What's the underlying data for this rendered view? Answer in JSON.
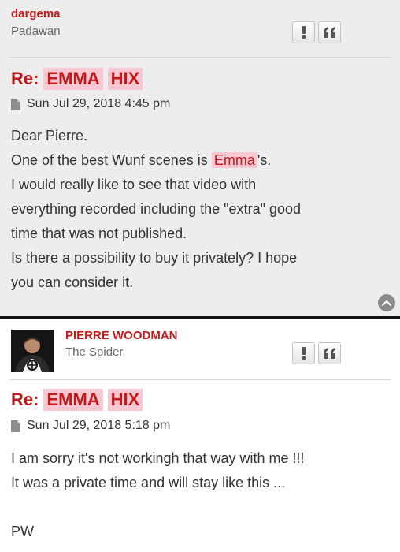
{
  "post1": {
    "username": "dargema",
    "rank": "Padawan",
    "title_prefix": "Re:",
    "title_word1": "EMMA",
    "title_word2": "HIX",
    "timestamp": "Sun Jul 29, 2018 4:45 pm",
    "body": {
      "greeting": "Dear Pierre.",
      "line2_before": "One of the best Wunf scenes is",
      "line2_highlight": "Emma",
      "line2_after": "'s.",
      "line3": "I would really like to see that video with",
      "line4": "everything recorded including the \"extra\" good",
      "line5": "time that was not published.",
      "line6": "Is there a possibility to buy it privately? I hope",
      "line7": "you can consider it."
    }
  },
  "post2": {
    "username": "PIERRE WOODMAN",
    "rank": "The Spider",
    "title_prefix": "Re:",
    "title_word1": "EMMA",
    "title_word2": "HIX",
    "timestamp": "Sun Jul 29, 2018 5:18 pm",
    "body": {
      "line1": "I am sorry it's not workingh that way with me !!!",
      "line2": "It was a private time and will stay like this ...",
      "signature": "PW"
    }
  },
  "icons": {
    "report": "exclamation-icon",
    "quote": "quote-icon",
    "post": "document-icon",
    "back_to_top": "chevron-up-icon"
  },
  "colors": {
    "accent": "#c21a1a",
    "highlight": "#f7c7d2",
    "post_bg": "#ededed"
  }
}
